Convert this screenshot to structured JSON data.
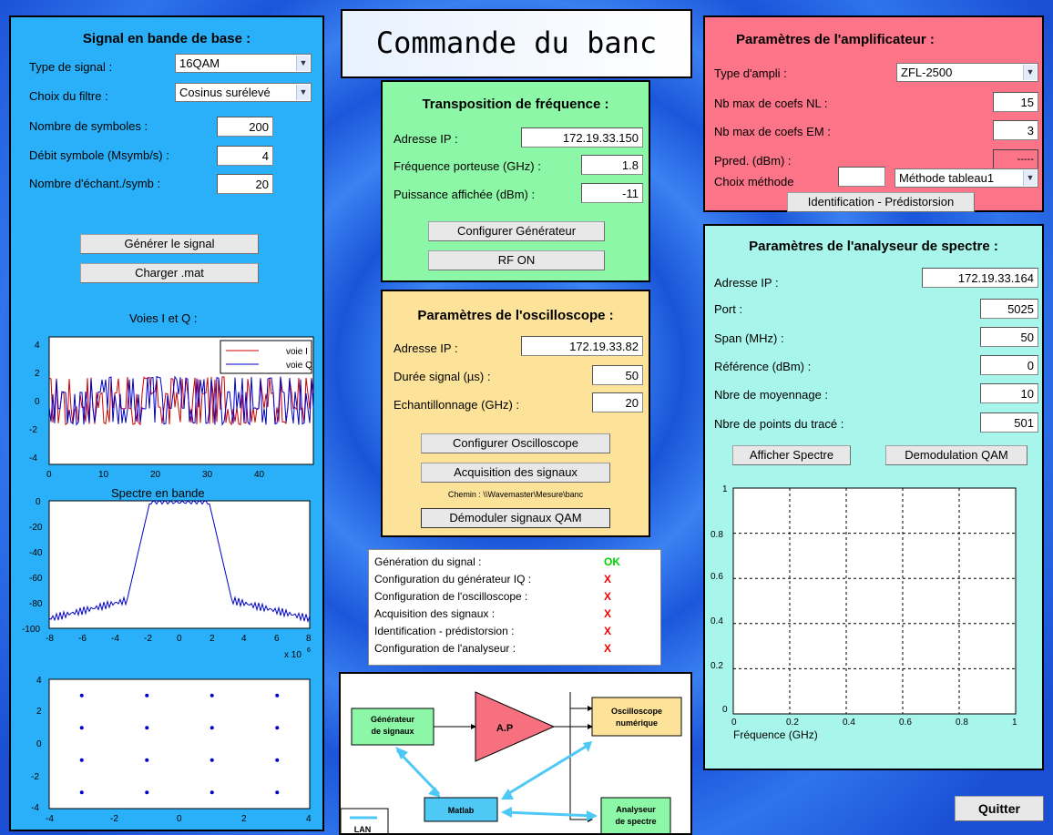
{
  "colors": {
    "left_panel": "#2ab0f8",
    "transpo_panel": "#8cf7a6",
    "osc_panel": "#fde39a",
    "ampli_panel": "#fc7488",
    "analyser_panel": "#a8f5ec",
    "ok": "#00d000",
    "fail": "#ee0000"
  },
  "title": "Commande du banc",
  "baseband": {
    "title": "Signal en bande de base :",
    "type_label": "Type de signal :",
    "type_value": "16QAM",
    "filter_label": "Choix du filtre :",
    "filter_value": "Cosinus surélevé",
    "nsym_label": "Nombre de symboles :",
    "nsym_value": "200",
    "rate_label": "Débit symbole (Msymb/s) :",
    "rate_value": "4",
    "nech_label": "Nombre d'échant./symb :",
    "nech_value": "20",
    "gen_button": "Générer le signal",
    "load_button": "Charger .mat"
  },
  "plot_iq": {
    "title": "Voies I et Q :",
    "legend_i": "voie I",
    "legend_q": "voie Q",
    "y_ticks": [
      "4",
      "2",
      "0",
      "-2",
      "-4"
    ],
    "x_ticks": [
      "0",
      "10",
      "20",
      "30",
      "40"
    ]
  },
  "plot_spectrum": {
    "title": "Spectre en bande",
    "y_ticks": [
      "0",
      "-20",
      "-40",
      "-60",
      "-80",
      "-100"
    ],
    "x_ticks": [
      "-8",
      "-6",
      "-4",
      "-2",
      "0",
      "2",
      "4",
      "6",
      "8"
    ],
    "x_exponent": "x 10",
    "x_exponent_power": "6"
  },
  "plot_constellation": {
    "y_ticks": [
      "4",
      "2",
      "0",
      "-2",
      "-4"
    ],
    "x_ticks": [
      "-4",
      "-2",
      "0",
      "2",
      "4"
    ],
    "points": [
      [
        -3,
        3
      ],
      [
        -1,
        3
      ],
      [
        1,
        3
      ],
      [
        3,
        3
      ],
      [
        -3,
        1
      ],
      [
        -1,
        1
      ],
      [
        1,
        1
      ],
      [
        3,
        1
      ],
      [
        -3,
        -1
      ],
      [
        -1,
        -1
      ],
      [
        1,
        -1
      ],
      [
        3,
        -1
      ],
      [
        -3,
        -3
      ],
      [
        -1,
        -3
      ],
      [
        1,
        -3
      ],
      [
        3,
        -3
      ]
    ]
  },
  "transpo": {
    "title": "Transposition de fréquence :",
    "ip_label": "Adresse IP :",
    "ip_value": "172.19.33.150",
    "freq_label": "Fréquence porteuse (GHz) :",
    "freq_value": "1.8",
    "power_label": "Puissance affichée (dBm) :",
    "power_value": "-11",
    "config_button": "Configurer Générateur",
    "rf_button": "RF ON"
  },
  "osc": {
    "title": "Paramètres de l'oscilloscope :",
    "ip_label": "Adresse IP :",
    "ip_value": "172.19.33.82",
    "dur_label": "Durée signal (µs) :",
    "dur_value": "50",
    "ech_label": "Echantillonnage (GHz) :",
    "ech_value": "20",
    "config_button": "Configurer Oscilloscope",
    "acq_button": "Acquisition des signaux",
    "path_text": "Chemin : \\\\Wavemaster\\Mesure\\banc",
    "demod_button": "Démoduler signaux QAM"
  },
  "status": {
    "rows": [
      {
        "label": "Génération du signal :",
        "value": "OK",
        "ok": true
      },
      {
        "label": "Configuration du générateur IQ :",
        "value": "X",
        "ok": false
      },
      {
        "label": "Configuration de l'oscilloscope :",
        "value": "X",
        "ok": false
      },
      {
        "label": "Acquisition des signaux :",
        "value": "X",
        "ok": false
      },
      {
        "label": "Identification - prédistorsion :",
        "value": "X",
        "ok": false
      },
      {
        "label": "Configuration de l'analyseur :",
        "value": "X",
        "ok": false
      }
    ]
  },
  "diagram": {
    "gen": "Générateur",
    "gen2": "de signaux",
    "ap": "A.P",
    "osc": "Oscilloscope",
    "osc2": "numérique",
    "matlab": "Matlab",
    "analyser": "Analyseur",
    "analyser2": "de spectre",
    "lan": "LAN"
  },
  "ampli": {
    "title": "Paramètres de l'amplificateur :",
    "type_label": "Type d'ampli :",
    "type_value": "ZFL-2500",
    "nl_label": "Nb max de coefs NL :",
    "nl_value": "15",
    "em_label": "Nb max de coefs EM :",
    "em_value": "3",
    "ppred_label": "Ppred. (dBm) :",
    "ppred_value": "-----",
    "method_label": "Choix méthode",
    "method_input": "",
    "method_value": "Méthode tableau1",
    "ident_button": "Identification - Prédistorsion"
  },
  "analyser": {
    "title": "Paramètres de l'analyseur de spectre :",
    "ip_label": "Adresse IP :",
    "ip_value": "172.19.33.164",
    "port_label": "Port :",
    "port_value": "5025",
    "span_label": "Span (MHz) :",
    "span_value": "50",
    "ref_label": "Référence (dBm) :",
    "ref_value": "0",
    "avg_label": "Nbre de moyennage :",
    "avg_value": "10",
    "pts_label": "Nbre de points du tracé :",
    "pts_value": "501",
    "show_button": "Afficher Spectre",
    "demod_button": "Demodulation QAM"
  },
  "plot_analyser": {
    "y_ticks": [
      "1",
      "0.8",
      "0.6",
      "0.4",
      "0.2",
      "0"
    ],
    "x_ticks": [
      "0",
      "0.2",
      "0.4",
      "0.6",
      "0.8",
      "1"
    ],
    "xlabel": "Fréquence (GHz)"
  },
  "quit_button": "Quitter"
}
